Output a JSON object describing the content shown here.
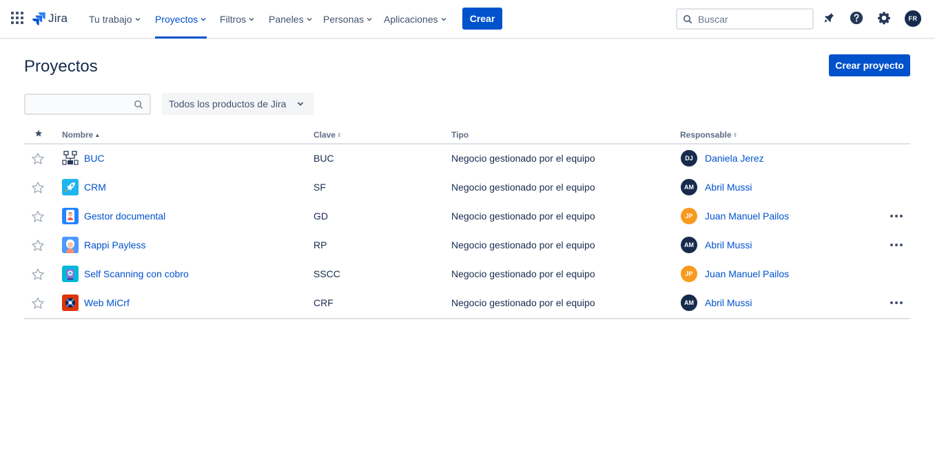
{
  "nav": {
    "logo_text": "Jira",
    "items": [
      {
        "label": "Tu trabajo"
      },
      {
        "label": "Proyectos"
      },
      {
        "label": "Filtros"
      },
      {
        "label": "Paneles"
      },
      {
        "label": "Personas"
      },
      {
        "label": "Aplicaciones"
      }
    ],
    "active_item": "Proyectos",
    "create_label": "Crear",
    "search_placeholder": "Buscar",
    "user_initials": "FR",
    "icons": [
      "app-switcher-icon",
      "jira-logo-icon",
      "search-icon",
      "notifications-icon",
      "help-icon",
      "settings-icon"
    ]
  },
  "page": {
    "title": "Proyectos",
    "create_project_label": "Crear proyecto",
    "filter_value": "",
    "product_filter": "Todos los productos de Jira"
  },
  "table": {
    "headers": {
      "name": "Nombre",
      "key": "Clave",
      "type": "Tipo",
      "lead": "Responsable"
    },
    "sorted_by": "Nombre",
    "rows": [
      {
        "name": "BUC",
        "key": "BUC",
        "type": "Negocio gestionado por el equipo",
        "lead_initials": "DJ",
        "lead": "Daniela Jerez",
        "lead_color": "#172b4d",
        "icon": "network-diagram-icon",
        "has_more": false
      },
      {
        "name": "CRM",
        "key": "SF",
        "type": "Negocio gestionado por el equipo",
        "lead_initials": "AM",
        "lead": "Abril Mussi",
        "lead_color": "#172b4d",
        "icon": "rocket-icon",
        "has_more": false
      },
      {
        "name": "Gestor documental",
        "key": "GD",
        "type": "Negocio gestionado por el equipo",
        "lead_initials": "JP",
        "lead": "Juan Manuel Pailos",
        "lead_color": "#f79a1e",
        "icon": "phone-person-icon",
        "has_more": true
      },
      {
        "name": "Rappi Payless",
        "key": "RP",
        "type": "Negocio gestionado por el equipo",
        "lead_initials": "AM",
        "lead": "Abril Mussi",
        "lead_color": "#172b4d",
        "icon": "person-avatar-icon",
        "has_more": true
      },
      {
        "name": "Self Scanning con cobro",
        "key": "SSCC",
        "type": "Negocio gestionado por el equipo",
        "lead_initials": "JP",
        "lead": "Juan Manuel Pailos",
        "lead_color": "#f79a1e",
        "icon": "robot-icon",
        "has_more": false
      },
      {
        "name": "Web MiCrf",
        "key": "CRF",
        "type": "Negocio gestionado por el equipo",
        "lead_initials": "AM",
        "lead": "Abril Mussi",
        "lead_color": "#172b4d",
        "icon": "satellite-icon",
        "has_more": true
      }
    ]
  },
  "colors": {
    "primary": "#0052cc",
    "text": "#172b4d",
    "subtle": "#42526e",
    "border": "#dfe1e6"
  }
}
